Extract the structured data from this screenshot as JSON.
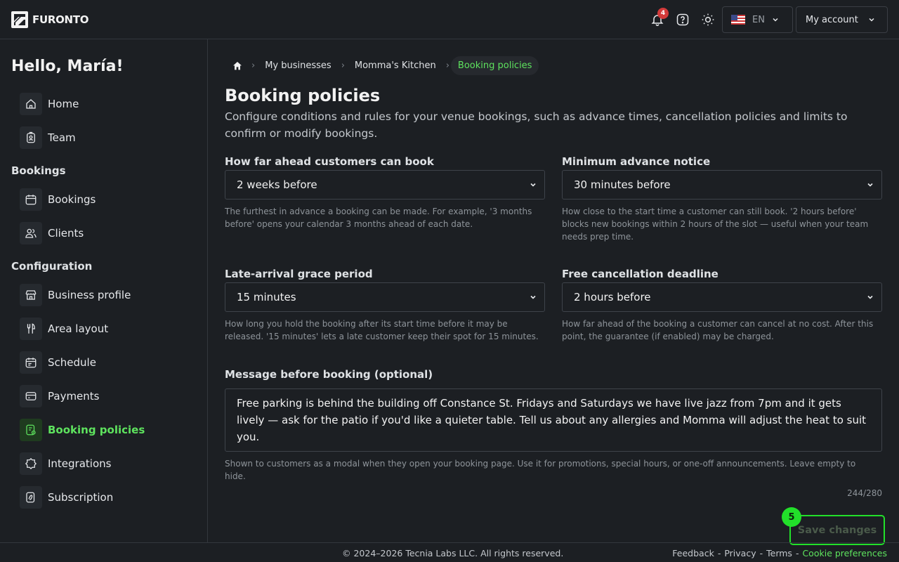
{
  "brand": {
    "name": "FURONTO"
  },
  "topbar": {
    "notifications_count": "4",
    "language": "EN",
    "account_label": "My account"
  },
  "sidebar": {
    "greeting": "Hello, María!",
    "sections": {
      "bookings": "Bookings",
      "configuration": "Configuration"
    },
    "items": [
      {
        "label": "Home",
        "icon": "home-icon"
      },
      {
        "label": "Team",
        "icon": "badge-icon"
      },
      {
        "label": "Bookings",
        "icon": "calendar-icon"
      },
      {
        "label": "Clients",
        "icon": "users-icon"
      },
      {
        "label": "Business profile",
        "icon": "storefront-icon"
      },
      {
        "label": "Area layout",
        "icon": "cutlery-icon"
      },
      {
        "label": "Schedule",
        "icon": "schedule-icon"
      },
      {
        "label": "Payments",
        "icon": "card-icon"
      },
      {
        "label": "Booking policies",
        "icon": "policy-icon",
        "active": true
      },
      {
        "label": "Integrations",
        "icon": "puzzle-icon"
      },
      {
        "label": "Subscription",
        "icon": "subscription-icon"
      }
    ]
  },
  "breadcrumb": {
    "items": [
      "My businesses",
      "Momma's Kitchen"
    ],
    "current": "Booking policies"
  },
  "page": {
    "title": "Booking policies",
    "subtitle": "Configure conditions and rules for your venue bookings, such as advance times, cancellation policies and limits to confirm or modify bookings."
  },
  "fields": {
    "advance": {
      "label": "How far ahead customers can book",
      "value": "2 weeks before",
      "help": "The furthest in advance a booking can be made. For example, '3 months before' opens your calendar 3 months ahead of each date."
    },
    "min_notice": {
      "label": "Minimum advance notice",
      "value": "30 minutes before",
      "help": "How close to the start time a customer can still book. '2 hours before' blocks new bookings within 2 hours of the slot — useful when your team needs prep time."
    },
    "grace": {
      "label": "Late-arrival grace period",
      "value": "15 minutes",
      "help": "How long you hold the booking after its start time before it may be released. '15 minutes' lets a late customer keep their spot for 15 minutes."
    },
    "cancel": {
      "label": "Free cancellation deadline",
      "value": "2 hours before",
      "help": "How far ahead of the booking a customer can cancel at no cost. After this point, the guarantee (if enabled) may be charged."
    }
  },
  "message": {
    "label": "Message before booking (optional)",
    "value": "Free parking is behind the building off Constance St. Fridays and Saturdays we have live jazz from 7pm and it gets lively — ask for the patio if you'd like a quieter table. Tell us about any allergies and Momma will adjust the heat to suit you.",
    "help": "Shown to customers as a modal when they open your booking page. Use it for promotions, special hours, or one-off announcements. Leave empty to hide.",
    "counter": "244/280"
  },
  "actions": {
    "save_label": "Save changes",
    "step_badge": "5"
  },
  "footer": {
    "copyright": "© 2024–2026 Tecnia Labs LLC. All rights reserved.",
    "links": [
      "Feedback",
      "Privacy",
      "Terms"
    ],
    "cookie_link": "Cookie preferences",
    "separator": "-"
  },
  "colors": {
    "background": "#1c1f23",
    "accent": "#22e02a",
    "accent_text": "#5ee35e",
    "badge": "#d23a3a"
  }
}
